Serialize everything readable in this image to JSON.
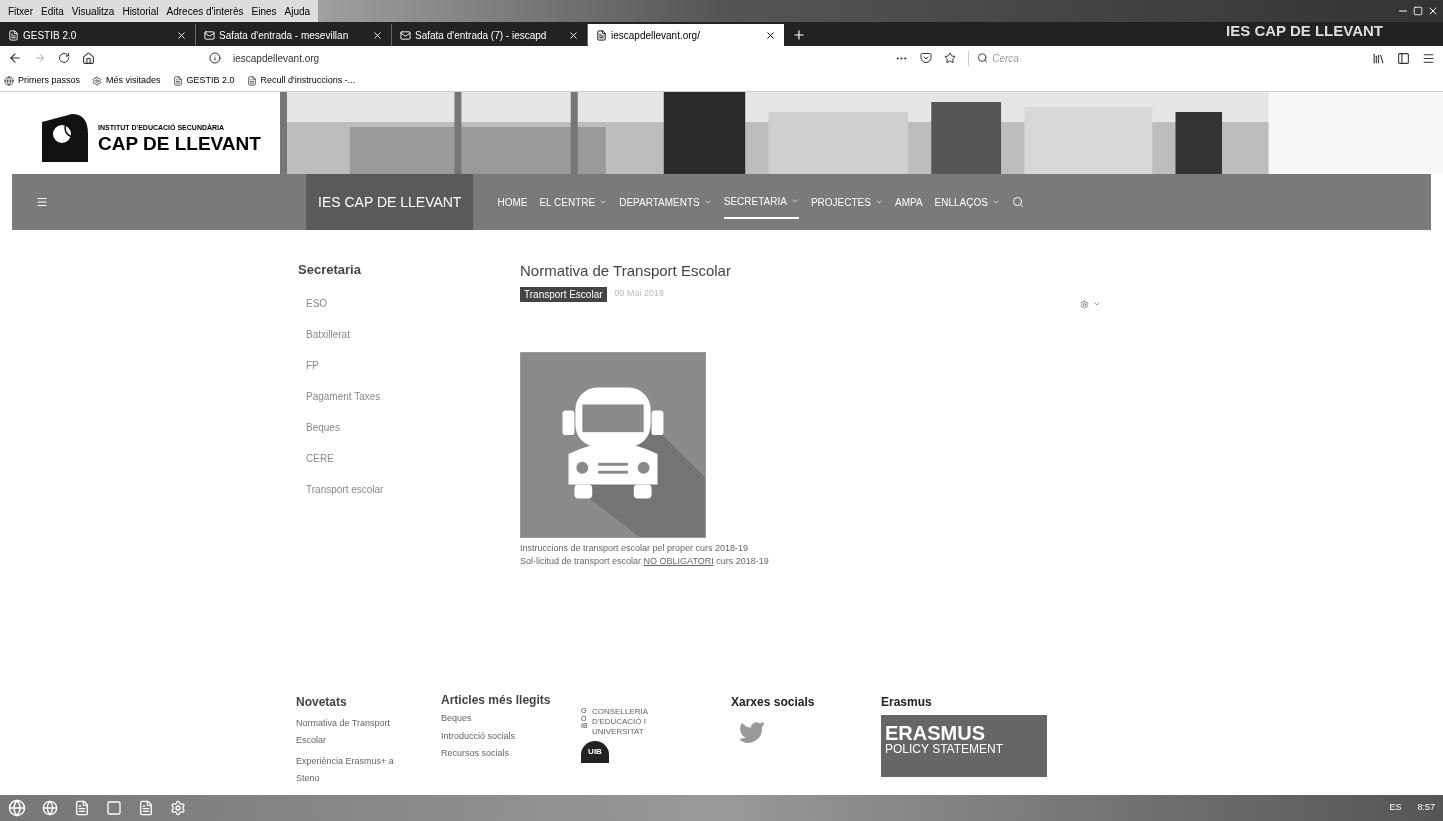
{
  "menu_bar": [
    "Fitxer",
    "Edita",
    "Visualitza",
    "Historial",
    "Adreces d'interès",
    "Eines",
    "Ajuda"
  ],
  "window": {
    "title": "IES CAP DE LLEVANT"
  },
  "tabs": [
    {
      "label": "GESTIB 2.0",
      "kind": "page",
      "selected": false
    },
    {
      "label": "Safata d'entrada - mesevillan",
      "kind": "mail",
      "selected": false
    },
    {
      "label": "Safata d'entrada (7) - iescapd",
      "kind": "mail",
      "selected": false
    },
    {
      "label": "iescapdellevant.org/",
      "kind": "page",
      "selected": true
    }
  ],
  "address": {
    "url": "iescapdellevant.org"
  },
  "search": {
    "placeholder": "Cerca"
  },
  "bookmarks": [
    {
      "label": "Primers passos",
      "kind": "globe"
    },
    {
      "label": "Més visitades",
      "kind": "gear"
    },
    {
      "label": "GESTIB 2.0",
      "kind": "page"
    },
    {
      "label": "Recull d'instruccions -...",
      "kind": "page"
    }
  ],
  "header": {
    "kicker": "INSTITUT D'EDUCACIÓ SECUNDÀRIA",
    "name": "CAP DE LLEVANT"
  },
  "nav": {
    "brand": "IES CAP DE LLEVANT",
    "items": [
      {
        "label": "HOME",
        "dropdown": false,
        "selected": false
      },
      {
        "label": "EL CENTRE",
        "dropdown": true,
        "selected": false
      },
      {
        "label": "DEPARTAMENTS",
        "dropdown": true,
        "selected": false
      },
      {
        "label": "SECRETARIA",
        "dropdown": true,
        "selected": true
      },
      {
        "label": "PROJECTES",
        "dropdown": true,
        "selected": false
      },
      {
        "label": "AMPA",
        "dropdown": false,
        "selected": false
      },
      {
        "label": "ENLLAÇOS",
        "dropdown": true,
        "selected": false
      }
    ]
  },
  "sidebar": {
    "title": "Secretaria",
    "items": [
      "ESO",
      "Batxillerat",
      "FP",
      "Pagament Taxes",
      "Beques",
      "CERE",
      "Transport escolar"
    ]
  },
  "article": {
    "title": "Normativa de Transport Escolar",
    "tag": "Transport Escolar",
    "date": "09 Mai 2018",
    "lines": [
      {
        "text": "Instruccions de transport escolar pel proper curs 2018-19"
      },
      {
        "text": "Sol·licitud de transport escolar",
        "link": "NO OBLIGATORI",
        "after": "curs 2018-19"
      }
    ]
  },
  "footer": {
    "news": {
      "title": "Novetats",
      "items": [
        "Normativa de Transport Escolar",
        "Experiència Erasmus+ a Steno"
      ]
    },
    "popular": {
      "title": "Articles més llegits",
      "items": [
        "Beques",
        "Introducció socials",
        "Recursos socials"
      ]
    },
    "govern": {
      "letters": "GOIB",
      "text": "CONSELLERIA D'EDUCACIÓ I UNIVERSITAT",
      "uib": "UIB"
    },
    "social": {
      "title": "Xarxes socials"
    },
    "erasmus": {
      "title": "Erasmus",
      "banner": "ERASMUS",
      "sub": "POLICY STATEMENT"
    }
  },
  "taskbar": {
    "lang": "ES",
    "time": "8:57"
  }
}
